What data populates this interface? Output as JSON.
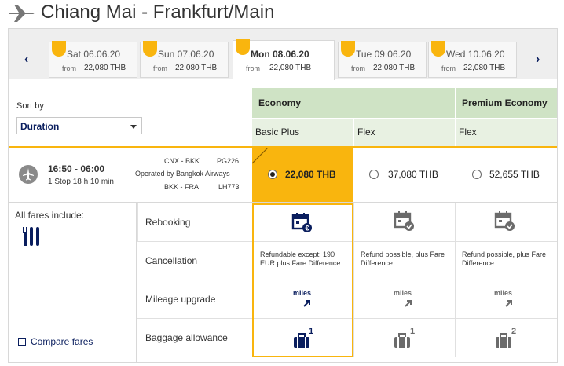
{
  "route": {
    "title": "Chiang Mai - Frankfurt/Main"
  },
  "dates": [
    {
      "label": "Sat 06.06.20",
      "from": "from",
      "price": "22,080 THB",
      "active": false
    },
    {
      "label": "Sun 07.06.20",
      "from": "from",
      "price": "22,080 THB",
      "active": false
    },
    {
      "label": "Mon 08.06.20",
      "from": "from",
      "price": "22,080 THB",
      "active": true
    },
    {
      "label": "Tue 09.06.20",
      "from": "from",
      "price": "22,080 THB",
      "active": false
    },
    {
      "label": "Wed 10.06.20",
      "from": "from",
      "price": "22,080 THB",
      "active": false
    }
  ],
  "nav": {
    "prev": "‹",
    "next": "›"
  },
  "sort": {
    "label": "Sort by",
    "value": "Duration"
  },
  "cabins": {
    "economy": "Economy",
    "premium": "Premium Economy"
  },
  "fares": {
    "basic_plus": "Basic Plus",
    "flex": "Flex",
    "premium_flex": "Flex"
  },
  "flight": {
    "times": "16:50 - 06:00",
    "stops": "1 Stop 18 h 10 min",
    "seg1_route": "CNX - BKK",
    "seg1_flight": "PG226",
    "operated_by": "Operated by Bangkok Airways",
    "seg2_route": "BKK - FRA",
    "seg2_flight": "LH773",
    "prices": {
      "basic_plus": "22,080 THB",
      "flex": "37,080 THB",
      "premium_flex": "52,655 THB"
    },
    "selected": "basic_plus"
  },
  "includes": {
    "label": "All fares include:",
    "compare": "Compare fares"
  },
  "features": {
    "rebooking": {
      "name": "Rebooking"
    },
    "cancellation": {
      "name": "Cancellation",
      "basic_plus": "Refundable except: 190 EUR plus Fare Difference",
      "flex": "Refund possible, plus Fare Difference",
      "premium_flex": "Refund possible, plus Fare Difference"
    },
    "mileage": {
      "name": "Mileage upgrade",
      "word": "miles"
    },
    "baggage": {
      "name": "Baggage allowance",
      "basic_plus": "1",
      "flex": "1",
      "premium_flex": "2"
    }
  },
  "colors": {
    "accent": "#f9b50e",
    "navy": "#0a1e5e",
    "cabin_bg": "#cfe3c5",
    "grey_icon": "#6b6b6b"
  }
}
